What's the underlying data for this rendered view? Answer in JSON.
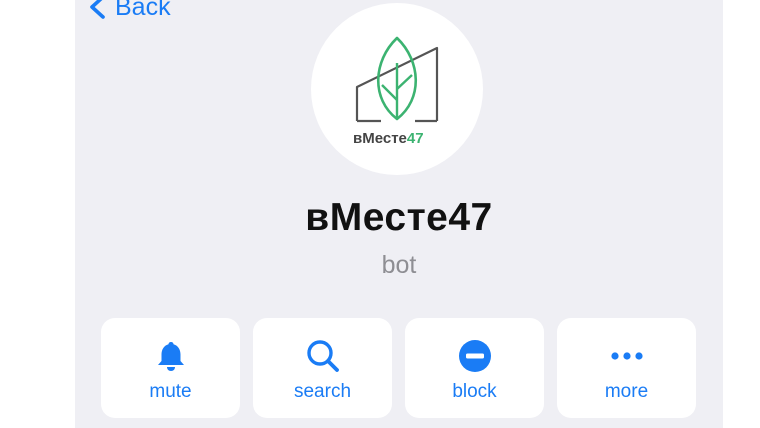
{
  "header": {
    "back_label": "Back"
  },
  "profile": {
    "logo_text_main": "вМесте",
    "logo_text_accent": "47",
    "name": "вМесте47",
    "subtitle": "bot"
  },
  "actions": [
    {
      "label": "mute",
      "icon": "bell-icon"
    },
    {
      "label": "search",
      "icon": "search-icon"
    },
    {
      "label": "block",
      "icon": "block-icon"
    },
    {
      "label": "more",
      "icon": "more-icon"
    }
  ],
  "colors": {
    "accent": "#1a7cf5",
    "background": "#efeff4",
    "card": "#ffffff",
    "logo_green": "#3cb371",
    "logo_gray": "#555555"
  }
}
